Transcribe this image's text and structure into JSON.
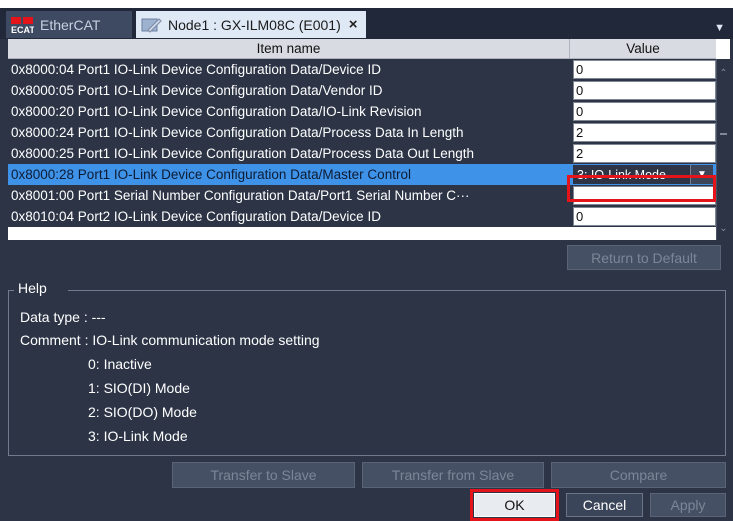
{
  "tabs": [
    {
      "label": "EtherCAT",
      "icon": "ecat-icon"
    },
    {
      "label": "Node1 : GX-ILM08C (E001)",
      "icon": "node-config-icon",
      "close": "×"
    }
  ],
  "table": {
    "col_name": "Item name",
    "col_value": "Value",
    "rows": [
      {
        "name": "0x8000:04 Port1 IO-Link Device Configuration Data/Device ID",
        "value": "0"
      },
      {
        "name": "0x8000:05 Port1 IO-Link Device Configuration Data/Vendor ID",
        "value": "0"
      },
      {
        "name": "0x8000:20 Port1 IO-Link Device Configuration Data/IO-Link Revision",
        "value": "0"
      },
      {
        "name": "0x8000:24 Port1 IO-Link Device Configuration Data/Process Data In Length",
        "value": "2"
      },
      {
        "name": "0x8000:25 Port1 IO-Link Device Configuration Data/Process Data Out Length",
        "value": "2"
      },
      {
        "name": "0x8000:28 Port1 IO-Link Device Configuration Data/Master Control",
        "value": "3: IO-Link Mode"
      },
      {
        "name": "0x8001:00 Port1 Serial Number Configuration Data/Port1 Serial Number C···",
        "value": ""
      },
      {
        "name": "0x8010:04 Port2 IO-Link Device Configuration Data/Device ID",
        "value": "0"
      }
    ]
  },
  "buttons": {
    "return_default": "Return to Default",
    "transfer_to_slave": "Transfer to Slave",
    "transfer_from_slave": "Transfer from Slave",
    "compare": "Compare",
    "ok": "OK",
    "cancel": "Cancel",
    "apply": "Apply"
  },
  "help": {
    "title": "Help",
    "data_type": "Data type : ---",
    "comment": "Comment : IO-Link communication mode setting",
    "options": [
      "0: Inactive",
      "1: SIO(DI) Mode",
      "2: SIO(DO) Mode",
      "3: IO-Link Mode"
    ]
  },
  "colors": {
    "highlight": "#e5141b",
    "selection": "#3e92e8",
    "background": "#2c3446"
  }
}
